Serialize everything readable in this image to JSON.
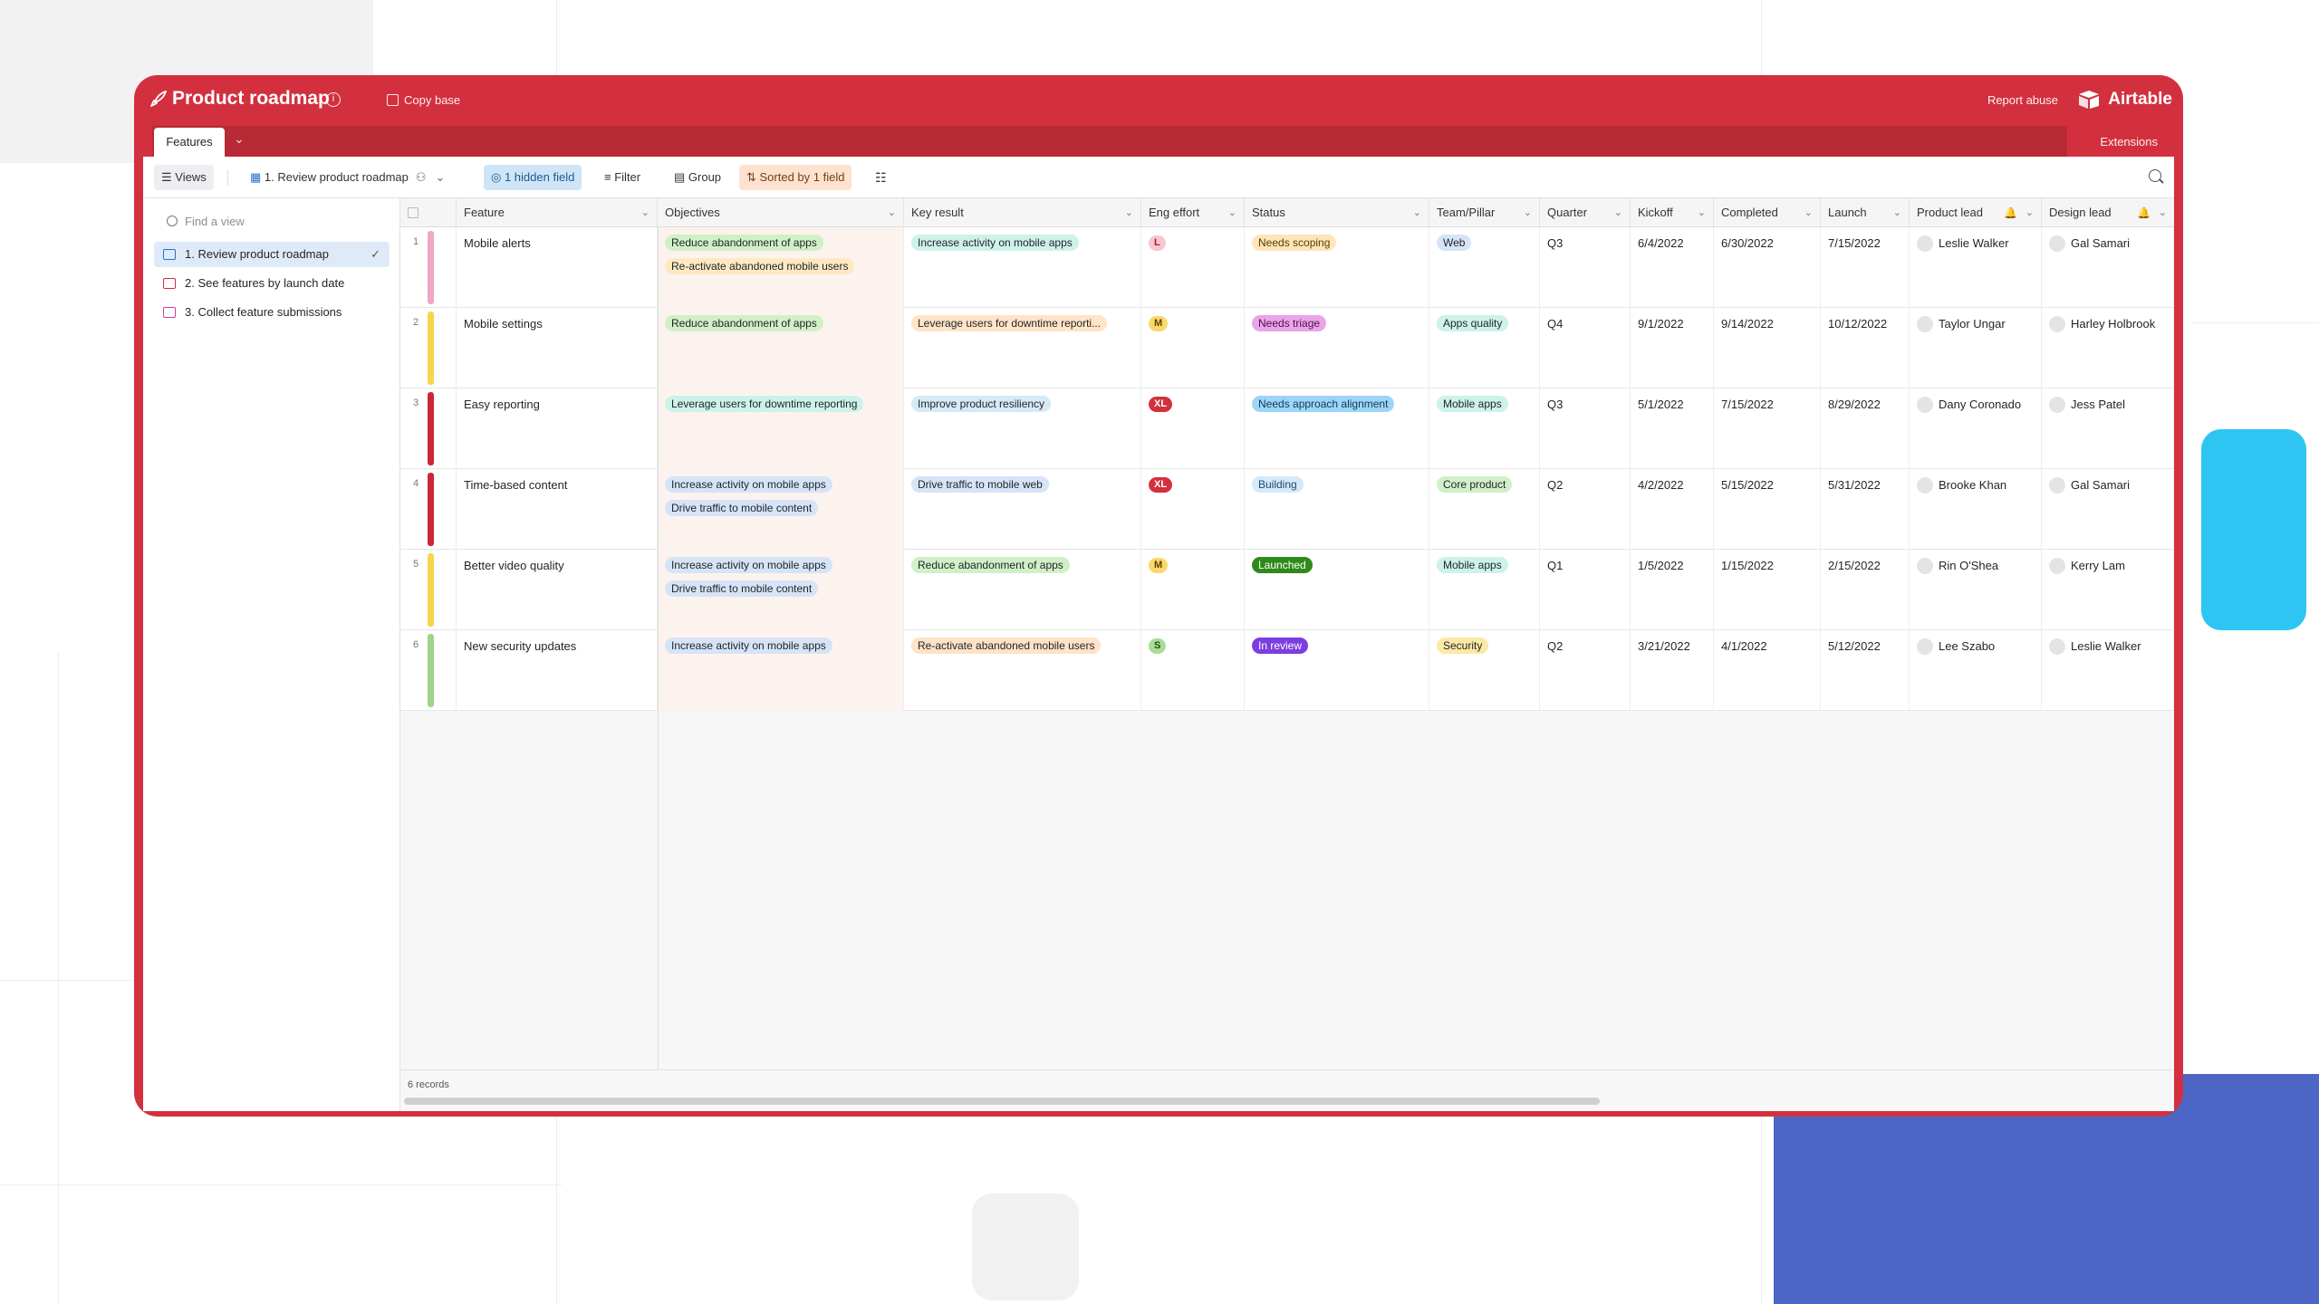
{
  "app": {
    "base_title": "Product roadmap",
    "copy_base": "Copy base",
    "report_abuse": "Report abuse",
    "brand": "Airtable",
    "accent": "#d3303f"
  },
  "tabs": {
    "active": "Features",
    "extensions": "Extensions"
  },
  "toolbar": {
    "views": "Views",
    "current_view": "1. Review product roadmap",
    "hidden": "1 hidden field",
    "filter": "Filter",
    "group": "Group",
    "sorted": "Sorted by 1 field"
  },
  "sidebar": {
    "search_placeholder": "Find a view",
    "views": [
      {
        "label": "1. Review product roadmap",
        "icon": "grid-view-icon"
      },
      {
        "label": "2. See features by launch date",
        "icon": "calendar-view-icon"
      },
      {
        "label": "3. Collect feature submissions",
        "icon": "form-view-icon"
      }
    ]
  },
  "columns": [
    "Feature",
    "Objectives",
    "Key result",
    "Eng effort",
    "Status",
    "Team/Pillar",
    "Quarter",
    "Kickoff",
    "Completed",
    "Launch",
    "Product lead",
    "Design lead"
  ],
  "rows": [
    {
      "n": "1",
      "feature": "Mobile alerts",
      "bar": "#f0a6c4",
      "objectives": [
        "Reduce abandonment of apps",
        "Re-activate abandoned mobile users"
      ],
      "key_result": "Increase activity on mobile apps",
      "effort": "L",
      "status": "Needs scoping",
      "team": "Web",
      "quarter": "Q3",
      "kickoff": "6/4/2022",
      "completed": "6/30/2022",
      "launch": "7/15/2022",
      "product_lead": "Leslie Walker",
      "design_lead": "Gal Samari"
    },
    {
      "n": "2",
      "feature": "Mobile settings",
      "bar": "#f5d64a",
      "objectives": [
        "Reduce abandonment of apps"
      ],
      "key_result": "Leverage users for downtime reporti...",
      "effort": "M",
      "status": "Needs triage",
      "team": "Apps quality",
      "quarter": "Q4",
      "kickoff": "9/1/2022",
      "completed": "9/14/2022",
      "launch": "10/12/2022",
      "product_lead": "Taylor Ungar",
      "design_lead": "Harley Holbrook"
    },
    {
      "n": "3",
      "feature": "Easy reporting",
      "bar": "#c8283a",
      "objectives": [
        "Leverage users for downtime reporting"
      ],
      "key_result": "Improve product resiliency",
      "effort": "XL",
      "status": "Needs approach alignment",
      "team": "Mobile apps",
      "quarter": "Q3",
      "kickoff": "5/1/2022",
      "completed": "7/15/2022",
      "launch": "8/29/2022",
      "product_lead": "Dany Coronado",
      "design_lead": "Jess Patel"
    },
    {
      "n": "4",
      "feature": "Time-based content",
      "bar": "#c8283a",
      "objectives": [
        "Increase activity on mobile apps",
        "Drive traffic to mobile content"
      ],
      "key_result": "Drive traffic to mobile web",
      "effort": "XL",
      "status": "Building",
      "team": "Core product",
      "quarter": "Q2",
      "kickoff": "4/2/2022",
      "completed": "5/15/2022",
      "launch": "5/31/2022",
      "product_lead": "Brooke Khan",
      "design_lead": "Gal Samari"
    },
    {
      "n": "5",
      "feature": "Better video quality",
      "bar": "#f5d64a",
      "objectives": [
        "Increase activity on mobile apps",
        "Drive traffic to mobile content"
      ],
      "key_result": "Reduce abandonment of apps",
      "effort": "M",
      "status": "Launched",
      "team": "Mobile apps",
      "quarter": "Q1",
      "kickoff": "1/5/2022",
      "completed": "1/15/2022",
      "launch": "2/15/2022",
      "product_lead": "Rin O'Shea",
      "design_lead": "Kerry Lam"
    },
    {
      "n": "6",
      "feature": "New security updates",
      "bar": "#9fd48a",
      "objectives": [
        "Increase activity on mobile apps"
      ],
      "key_result": "Re-activate abandoned mobile users",
      "effort": "S",
      "status": "In review",
      "team": "Security",
      "quarter": "Q2",
      "kickoff": "3/21/2022",
      "completed": "4/1/2022",
      "launch": "5/12/2022",
      "product_lead": "Lee Szabo",
      "design_lead": "Leslie Walker"
    }
  ],
  "colors": {
    "objective": {
      "Reduce abandonment of apps": "#d1f0c7",
      "Re-activate abandoned mobile users": "#ffe9c2",
      "Leverage users for downtime reporting": "#cdf2ea",
      "Increase activity on mobile apps": "#d6e4f7",
      "Drive traffic to mobile content": "#d6e4f7"
    },
    "key_result": {
      "Increase activity on mobile apps": "#cdf2ea",
      "Leverage users for downtime reporti...": "#ffe4c7",
      "Improve product resiliency": "#d6e9f7",
      "Drive traffic to mobile web": "#d6e4f7",
      "Reduce abandonment of apps": "#d1f0c7",
      "Re-activate abandoned mobile users": "#ffe2c7"
    },
    "effort": {
      "L": [
        "#f7c6cf",
        "#a3202f"
      ],
      "M": [
        "#fbd86a",
        "#5a4300"
      ],
      "XL": [
        "#d3303f",
        "#ffffff"
      ],
      "S": [
        "#a9dd95",
        "#1f4d12"
      ]
    },
    "status": {
      "Needs scoping": [
        "#ffe5b8",
        "#5a3b00"
      ],
      "Needs triage": [
        "#eaa4e8",
        "#4d1249"
      ],
      "Needs approach alignment": [
        "#9ed4f7",
        "#0f3b5a"
      ],
      "Building": [
        "#d6e9f7",
        "#1b4a73"
      ],
      "Launched": [
        "#2f8a1b",
        "#ffffff"
      ],
      "In review": [
        "#7b3fe0",
        "#ffffff"
      ]
    },
    "team": {
      "Web": "#d6e4f7",
      "Apps quality": "#cdf2ea",
      "Mobile apps": "#cdf2ea",
      "Core product": "#d1f0c7",
      "Security": "#fde9a6"
    }
  },
  "footer": {
    "records": "6 records"
  }
}
